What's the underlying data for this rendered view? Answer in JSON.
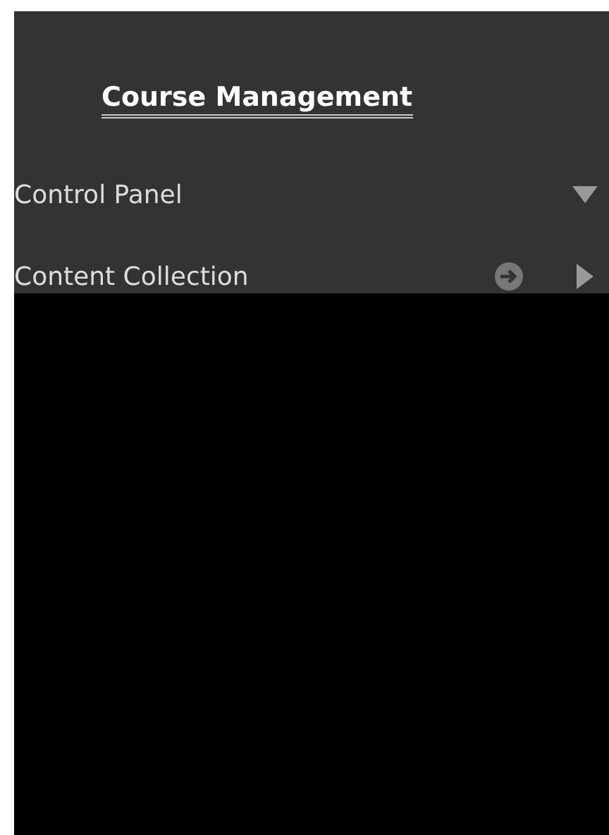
{
  "panel": {
    "title": "Course Management",
    "items": [
      {
        "label": "Control Panel",
        "expanded": true,
        "kind": "plain"
      },
      {
        "label": "Content Collection",
        "expanded": false,
        "kind": "link"
      }
    ]
  }
}
